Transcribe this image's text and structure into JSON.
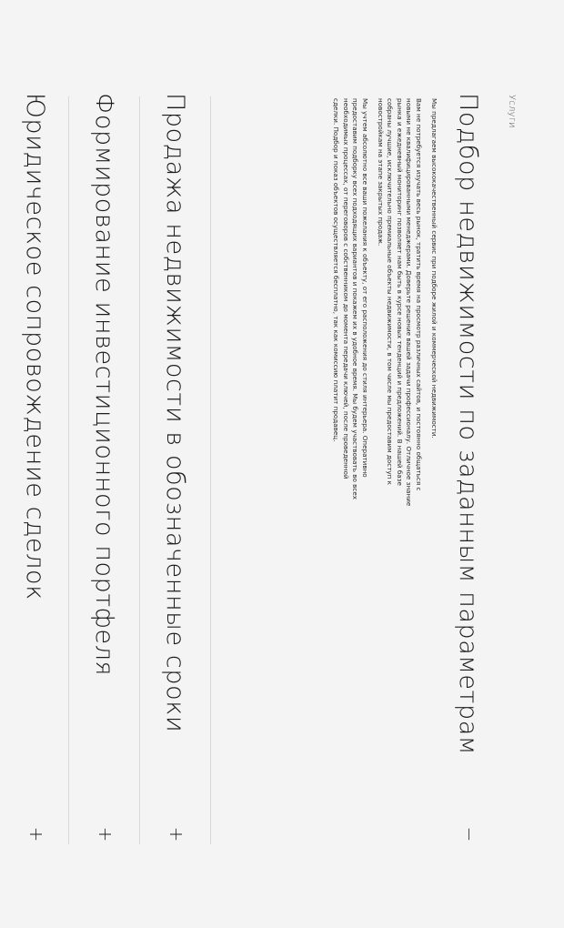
{
  "section": {
    "label": "Услуги"
  },
  "accordion": [
    {
      "title": "Подбор недвижимости по заданным параметрам",
      "toggle": "−",
      "expanded": true,
      "paragraphs": [
        "Мы предлагаем высококачественный сервис при подборе жилой и коммерческой недвижимости.",
        "Вам не потребуется изучать весь рынок, тратить время на просмотр различных сайтов, и постоянно общаться с новыми не квалифицированными менеджерами. Доверьте решение вашей задачи профессионалу. Отличное знание рынка и ежедневный мониторинг позволяет нам быть в курсе новых тенденций и предложений. В нашей базе собраны лучшие, исключительно премиальные объекты недвижимости, в том числе мы предоставим доступ к новостройкам на этапе закрытых продаж.",
        "Мы учтем абсолютно все ваши пожелания к объекту, от его расположения до стиля интерьера. Оперативно предоставим подборку всех подходящих вариантов и покажем их в удобное время. Мы будем участвовать во всех необходимых процессах, от переговоров с собственником до момента передачи ключей, после проведенной сделки. Подбор и показ объектов осуществляется бесплатно, так как комиссию платит продавец."
      ]
    },
    {
      "title": "Продажа недвижимости в обозначенные сроки",
      "toggle": "+",
      "expanded": false
    },
    {
      "title": "Формирование инвестиционного портфеля",
      "toggle": "+",
      "expanded": false
    },
    {
      "title": "Юридическое сопровождение сделок",
      "toggle": "+",
      "expanded": false
    }
  ]
}
